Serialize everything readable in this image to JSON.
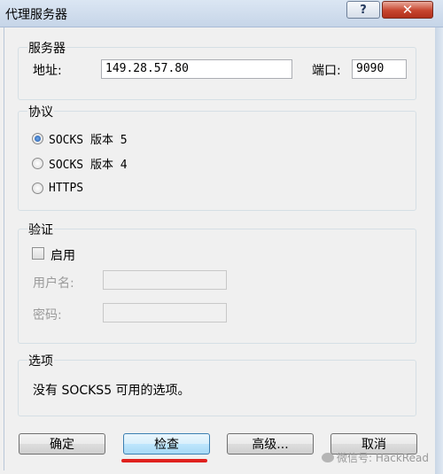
{
  "window": {
    "title": "代理服务器",
    "help_label": "?",
    "close_label": "✕"
  },
  "server": {
    "group_title": "服务器",
    "address_label": "地址:",
    "address_value": "149.28.57.80",
    "port_label": "端口:",
    "port_value": "9090"
  },
  "protocol": {
    "group_title": "协议",
    "options": [
      {
        "label": "SOCKS 版本 5",
        "checked": true
      },
      {
        "label": "SOCKS 版本 4",
        "checked": false
      },
      {
        "label": "HTTPS",
        "checked": false
      }
    ]
  },
  "auth": {
    "group_title": "验证",
    "enable_label": "启用",
    "enabled": false,
    "username_label": "用户名:",
    "username_value": "",
    "password_label": "密码:",
    "password_value": ""
  },
  "options": {
    "group_title": "选项",
    "text": "没有 SOCKS5 可用的选项。"
  },
  "buttons": {
    "ok": "确定",
    "check": "检查",
    "advanced": "高级...",
    "cancel": "取消"
  },
  "watermark": "微信号: HackRead"
}
